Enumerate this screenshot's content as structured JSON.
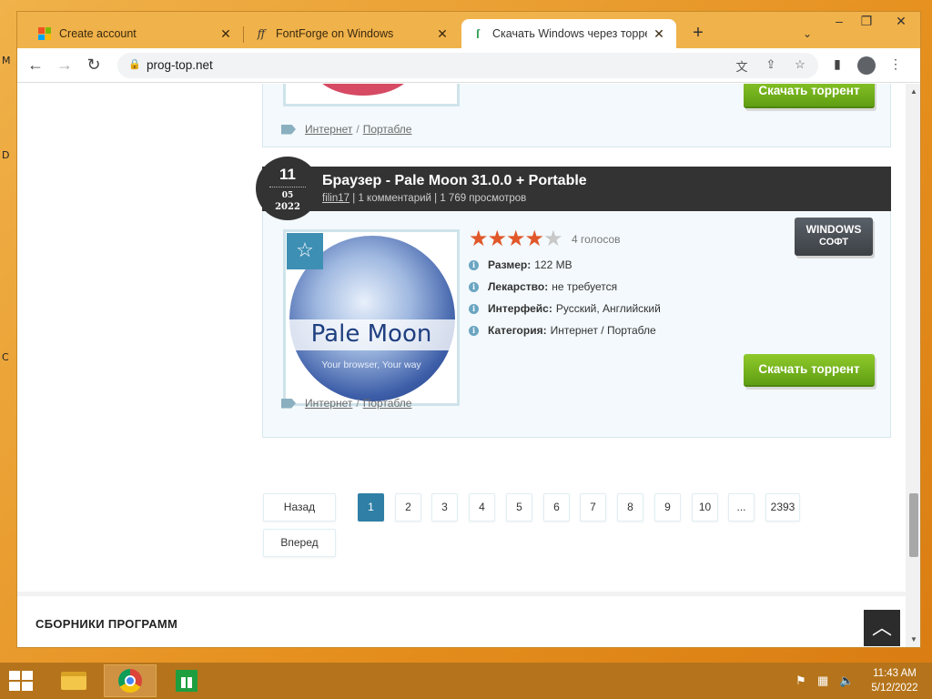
{
  "browser": {
    "tabs": [
      {
        "label": "Create account",
        "icon": "microsoft-icon",
        "active": false
      },
      {
        "label": "FontForge on Windows",
        "icon": "fontforge-icon",
        "active": false
      },
      {
        "label": "Скачать Windows через торрент",
        "icon": "progtop-icon",
        "active": true
      }
    ],
    "url": "prog-top.net"
  },
  "previous_post": {
    "download_label": "Скачать торрент",
    "tags": [
      "Интернет",
      "Портабле"
    ]
  },
  "post": {
    "date_day": "11",
    "date_month": "05",
    "date_year": "2022",
    "title": "Браузер - Pale Moon 31.0.0 + Portable",
    "author": "filin17",
    "comments": "1 комментарий",
    "views": "1 769 просмотров",
    "image_title": "Pale Moon",
    "image_subtitle": "Your browser, Your way",
    "rating": 4,
    "rating_max": 5,
    "votes": "4 голосов",
    "os_badge_line1": "WINDOWS",
    "os_badge_line2": "СОФТ",
    "info": [
      {
        "label": "Размер:",
        "value": "122 MB"
      },
      {
        "label": "Лекарство:",
        "value": "не требуется"
      },
      {
        "label": "Интерфейс:",
        "value": "Русский, Английский"
      },
      {
        "label": "Категория:",
        "value": "Интернет / Портабле"
      }
    ],
    "download_label": "Скачать торрент",
    "tags": [
      "Интернет",
      "Портабле"
    ]
  },
  "pagination": {
    "prev_label": "Назад",
    "next_label": "Вперед",
    "pages": [
      "1",
      "2",
      "3",
      "4",
      "5",
      "6",
      "7",
      "8",
      "9",
      "10",
      "...",
      "2393"
    ],
    "current": "1"
  },
  "collections": {
    "title": "СБОРНИКИ ПРОГРАММ"
  },
  "taskbar": {
    "time": "11:43 AM",
    "date": "5/12/2022"
  },
  "colors": {
    "accent_blue": "#2f7fa6",
    "download_green": "#6fb21c",
    "star_orange": "#e1572a",
    "desktop_orange": "#e9a23a"
  }
}
